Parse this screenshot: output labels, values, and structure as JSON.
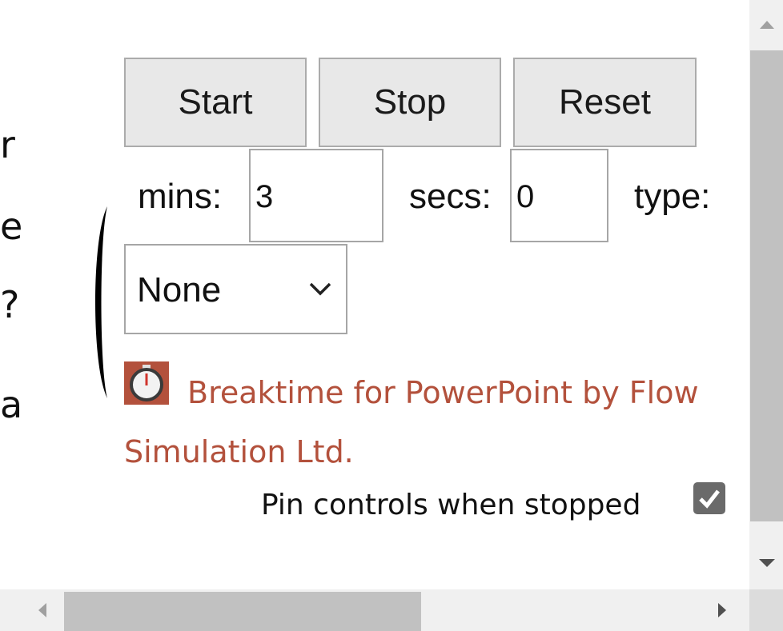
{
  "background_fragments": [
    "r",
    "e",
    "?",
    "a"
  ],
  "controls": {
    "start_label": "Start",
    "stop_label": "Stop",
    "reset_label": "Reset"
  },
  "timer": {
    "mins_label": "mins:",
    "mins_value": "3",
    "secs_label": "secs:",
    "secs_value": "0",
    "type_label": "type:",
    "type_selected": "None"
  },
  "branding": {
    "line1": "Breaktime for PowerPoint by Flow",
    "line2": "Simulation Ltd.",
    "link_color": "#b3513c",
    "icon": "stopwatch-icon"
  },
  "pin": {
    "label": "Pin controls when stopped",
    "checked": true
  },
  "colors": {
    "button_bg": "#e8e8e8",
    "scrollbar_thumb": "#c1c1c1",
    "scrollbar_track": "#f0f0f0"
  }
}
